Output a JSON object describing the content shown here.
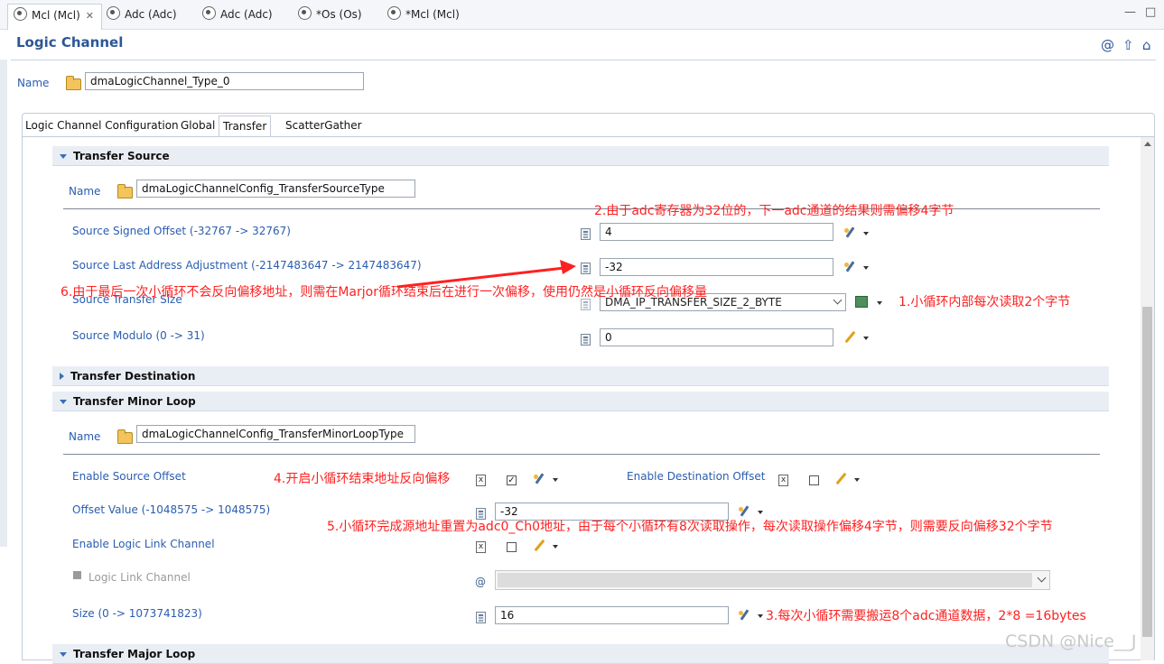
{
  "editor_tabs": [
    {
      "label": "Mcl (Mcl)",
      "close": "✕"
    },
    {
      "label": "Adc (Adc)"
    },
    {
      "label": "Adc (Adc)"
    },
    {
      "label": "*Os (Os)"
    },
    {
      "label": "*Mcl (Mcl)"
    }
  ],
  "window_controls": {
    "minimize": "—",
    "maximize": "□"
  },
  "header": {
    "title": "Logic Channel",
    "icons": [
      "at-icon",
      "arrow-up-icon",
      "home-icon"
    ]
  },
  "name_row": {
    "label": "Name",
    "value": "dmaLogicChannel_Type_0"
  },
  "sub_tabs": [
    "Logic Channel Configuration",
    "Global",
    "Transfer",
    "ScatterGather"
  ],
  "transfer_source": {
    "title": "Transfer Source",
    "name_label": "Name",
    "name_value": "dmaLogicChannelConfig_TransferSourceType",
    "signed_offset_label": "Source Signed Offset (-32767 -> 32767)",
    "signed_offset_value": "4",
    "last_addr_label": "Source Last Address Adjustment (-2147483647 -> 2147483647)",
    "last_addr_value": "-32",
    "transfer_size_label": "Source Transfer Size",
    "transfer_size_value": "DMA_IP_TRANSFER_SIZE_2_BYTE",
    "modulo_label": "Source Modulo (0 -> 31)",
    "modulo_value": "0"
  },
  "transfer_destination": {
    "title": "Transfer Destination"
  },
  "transfer_minor_loop": {
    "title": "Transfer Minor Loop",
    "name_label": "Name",
    "name_value": "dmaLogicChannelConfig_TransferMinorLoopType",
    "enable_src_offset_label": "Enable Source Offset",
    "enable_src_offset_checked": "✓",
    "enable_dst_offset_label": "Enable Destination Offset",
    "offset_value_label": "Offset Value (-1048575 -> 1048575)",
    "offset_value": "-32",
    "enable_link_label": "Enable Logic Link Channel",
    "link_channel_label": "Logic Link Channel",
    "size_label": "Size (0 -> 1073741823)",
    "size_value": "16"
  },
  "transfer_major_loop": {
    "title": "Transfer Major Loop"
  },
  "annotations": {
    "n1": "1.小循环内部每次读取2个字节",
    "n2": "2.由于adc寄存器为32位的，下一adc通道的结果则需偏移4字节",
    "n3": "3.每次小循环需要搬运8个adc通道数据，2*8 =16bytes",
    "n4": "4.开启小循环结束地址反向偏移",
    "n5": "5.小循环完成源地址重置为adc0_Ch0地址，由于每个小循环有8次读取操作，每次读取操作偏移4字节，则需要反向偏移32个字节",
    "n6": "6.由于最后一次小循环不会反向偏移地址，则需在Marjor循环结束后在进行一次偏移，使用仍然是小循环反向偏移量"
  },
  "watermark": "CSDN @Nice__J",
  "colors": {
    "accent": "#2b5797",
    "label": "#2a5db0",
    "annotation": "#ff2020",
    "section_bg": "#e9eef5"
  }
}
